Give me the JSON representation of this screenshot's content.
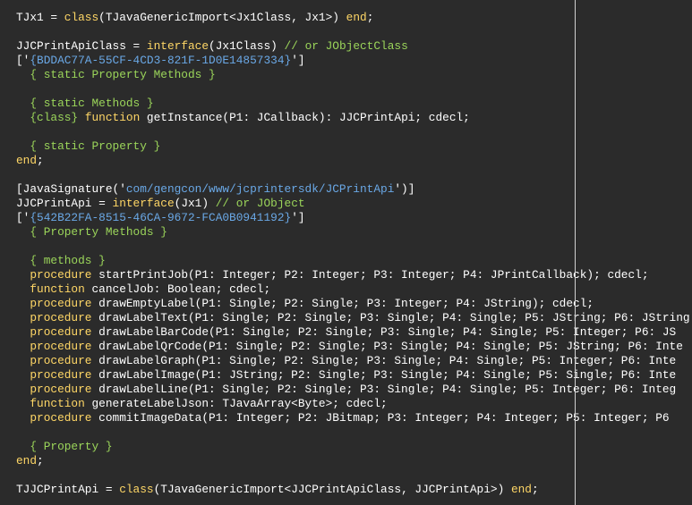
{
  "colors": {
    "background": "#2b2b2b",
    "text": "#ffffff",
    "keyword": "#ffd766",
    "comment": "#9bd55a",
    "string": "#6aa8e6",
    "margin_line": "#d0d0d0"
  },
  "code": {
    "lines": [
      [
        {
          "t": "TJx1 = ",
          "c": "p"
        },
        {
          "t": "class",
          "c": "kw"
        },
        {
          "t": "(TJavaGenericImport<Jx1Class, Jx1>) ",
          "c": "p"
        },
        {
          "t": "end",
          "c": "kw"
        },
        {
          "t": ";",
          "c": "p"
        }
      ],
      [],
      [
        {
          "t": "JJCPrintApiClass = ",
          "c": "p"
        },
        {
          "t": "interface",
          "c": "kw"
        },
        {
          "t": "(Jx1Class) ",
          "c": "p"
        },
        {
          "t": "// or JObjectClass",
          "c": "cm"
        }
      ],
      [
        {
          "t": "['",
          "c": "p"
        },
        {
          "t": "{BDDAC77A-55CF-4CD3-821F-1D0E14857334}",
          "c": "st"
        },
        {
          "t": "']",
          "c": "p"
        }
      ],
      [
        {
          "t": "  ",
          "c": "p"
        },
        {
          "t": "{ static Property Methods }",
          "c": "cm"
        }
      ],
      [],
      [
        {
          "t": "  ",
          "c": "p"
        },
        {
          "t": "{ static Methods }",
          "c": "cm"
        }
      ],
      [
        {
          "t": "  ",
          "c": "p"
        },
        {
          "t": "{class}",
          "c": "cm"
        },
        {
          "t": " ",
          "c": "p"
        },
        {
          "t": "function",
          "c": "kw"
        },
        {
          "t": " getInstance(P1: JCallback): JJCPrintApi; cdecl;",
          "c": "p"
        }
      ],
      [],
      [
        {
          "t": "  ",
          "c": "p"
        },
        {
          "t": "{ static Property }",
          "c": "cm"
        }
      ],
      [
        {
          "t": "end",
          "c": "kw"
        },
        {
          "t": ";",
          "c": "p"
        }
      ],
      [],
      [
        {
          "t": "[JavaSignature('",
          "c": "p"
        },
        {
          "t": "com/gengcon/www/jcprintersdk/JCPrintApi",
          "c": "st"
        },
        {
          "t": "')]",
          "c": "p"
        }
      ],
      [
        {
          "t": "JJCPrintApi = ",
          "c": "p"
        },
        {
          "t": "interface",
          "c": "kw"
        },
        {
          "t": "(Jx1) ",
          "c": "p"
        },
        {
          "t": "// or JObject",
          "c": "cm"
        }
      ],
      [
        {
          "t": "['",
          "c": "p"
        },
        {
          "t": "{542B22FA-8515-46CA-9672-FCA0B0941192}",
          "c": "st"
        },
        {
          "t": "']",
          "c": "p"
        }
      ],
      [
        {
          "t": "  ",
          "c": "p"
        },
        {
          "t": "{ Property Methods }",
          "c": "cm"
        }
      ],
      [],
      [
        {
          "t": "  ",
          "c": "p"
        },
        {
          "t": "{ methods }",
          "c": "cm"
        }
      ],
      [
        {
          "t": "  ",
          "c": "p"
        },
        {
          "t": "procedure",
          "c": "kw"
        },
        {
          "t": " startPrintJob(P1: Integer; P2: Integer; P3: Integer; P4: JPrintCallback); cdecl;",
          "c": "p"
        }
      ],
      [
        {
          "t": "  ",
          "c": "p"
        },
        {
          "t": "function",
          "c": "kw"
        },
        {
          "t": " cancelJob: Boolean; cdecl;",
          "c": "p"
        }
      ],
      [
        {
          "t": "  ",
          "c": "p"
        },
        {
          "t": "procedure",
          "c": "kw"
        },
        {
          "t": " drawEmptyLabel(P1: Single; P2: Single; P3: Integer; P4: JString); cdecl;",
          "c": "p"
        }
      ],
      [
        {
          "t": "  ",
          "c": "p"
        },
        {
          "t": "procedure",
          "c": "kw"
        },
        {
          "t": " drawLabelText(P1: Single; P2: Single; P3: Single; P4: Single; P5: JString; P6: JString",
          "c": "p"
        }
      ],
      [
        {
          "t": "  ",
          "c": "p"
        },
        {
          "t": "procedure",
          "c": "kw"
        },
        {
          "t": " drawLabelBarCode(P1: Single; P2: Single; P3: Single; P4: Single; P5: Integer; P6: JS",
          "c": "p"
        }
      ],
      [
        {
          "t": "  ",
          "c": "p"
        },
        {
          "t": "procedure",
          "c": "kw"
        },
        {
          "t": " drawLabelQrCode(P1: Single; P2: Single; P3: Single; P4: Single; P5: JString; P6: Inte",
          "c": "p"
        }
      ],
      [
        {
          "t": "  ",
          "c": "p"
        },
        {
          "t": "procedure",
          "c": "kw"
        },
        {
          "t": " drawLabelGraph(P1: Single; P2: Single; P3: Single; P4: Single; P5: Integer; P6: Inte",
          "c": "p"
        }
      ],
      [
        {
          "t": "  ",
          "c": "p"
        },
        {
          "t": "procedure",
          "c": "kw"
        },
        {
          "t": " drawLabelImage(P1: JString; P2: Single; P3: Single; P4: Single; P5: Single; P6: Inte",
          "c": "p"
        }
      ],
      [
        {
          "t": "  ",
          "c": "p"
        },
        {
          "t": "procedure",
          "c": "kw"
        },
        {
          "t": " drawLabelLine(P1: Single; P2: Single; P3: Single; P4: Single; P5: Integer; P6: Integ",
          "c": "p"
        }
      ],
      [
        {
          "t": "  ",
          "c": "p"
        },
        {
          "t": "function",
          "c": "kw"
        },
        {
          "t": " generateLabelJson: TJavaArray<Byte>; cdecl;",
          "c": "p"
        }
      ],
      [
        {
          "t": "  ",
          "c": "p"
        },
        {
          "t": "procedure",
          "c": "kw"
        },
        {
          "t": " commitImageData(P1: Integer; P2: JBitmap; P3: Integer; P4: Integer; P5: Integer; P6",
          "c": "p"
        }
      ],
      [],
      [
        {
          "t": "  ",
          "c": "p"
        },
        {
          "t": "{ Property }",
          "c": "cm"
        }
      ],
      [
        {
          "t": "end",
          "c": "kw"
        },
        {
          "t": ";",
          "c": "p"
        }
      ],
      [],
      [
        {
          "t": "TJJCPrintApi = ",
          "c": "p"
        },
        {
          "t": "class",
          "c": "kw"
        },
        {
          "t": "(TJavaGenericImport<JJCPrintApiClass, JJCPrintApi>) ",
          "c": "p"
        },
        {
          "t": "end",
          "c": "kw"
        },
        {
          "t": ";",
          "c": "p"
        }
      ]
    ]
  }
}
